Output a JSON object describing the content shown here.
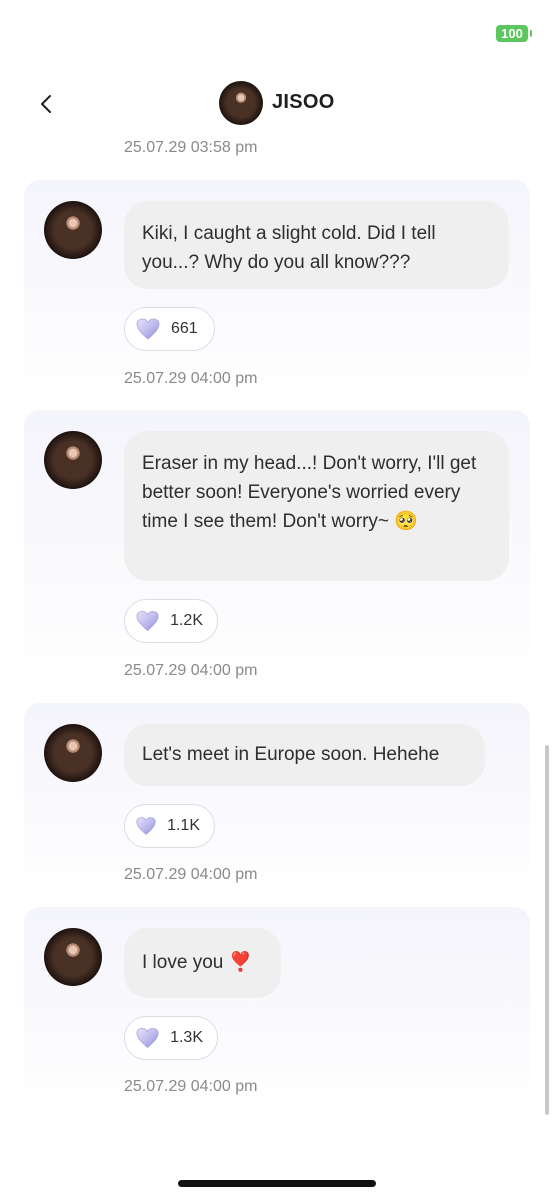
{
  "status": {
    "battery": "100"
  },
  "header": {
    "name": "JISOO"
  },
  "top_timestamp": "25.07.29 03:58 pm",
  "messages": [
    {
      "text": "Kiki, I caught a slight cold. Did I tell you...? Why do you all know???",
      "likes": "661",
      "time": "25.07.29 04:00 pm"
    },
    {
      "text": "Eraser in my head...! Don't worry, I'll get better soon! Everyone's worried every time I see them! Don't worry~",
      "emoji": "🥺",
      "likes": "1.2K",
      "time": "25.07.29 04:00 pm"
    },
    {
      "text": "Let's meet in Europe soon. Hehehe",
      "likes": "1.1K",
      "time": "25.07.29 04:00 pm"
    },
    {
      "text": "I love you",
      "emoji": "❣️",
      "likes": "1.3K",
      "time": "25.07.29 04:00 pm"
    }
  ],
  "colors": {
    "bubble": "#efefef",
    "battery": "#5cc75e",
    "heart": "#b9b4ea"
  }
}
